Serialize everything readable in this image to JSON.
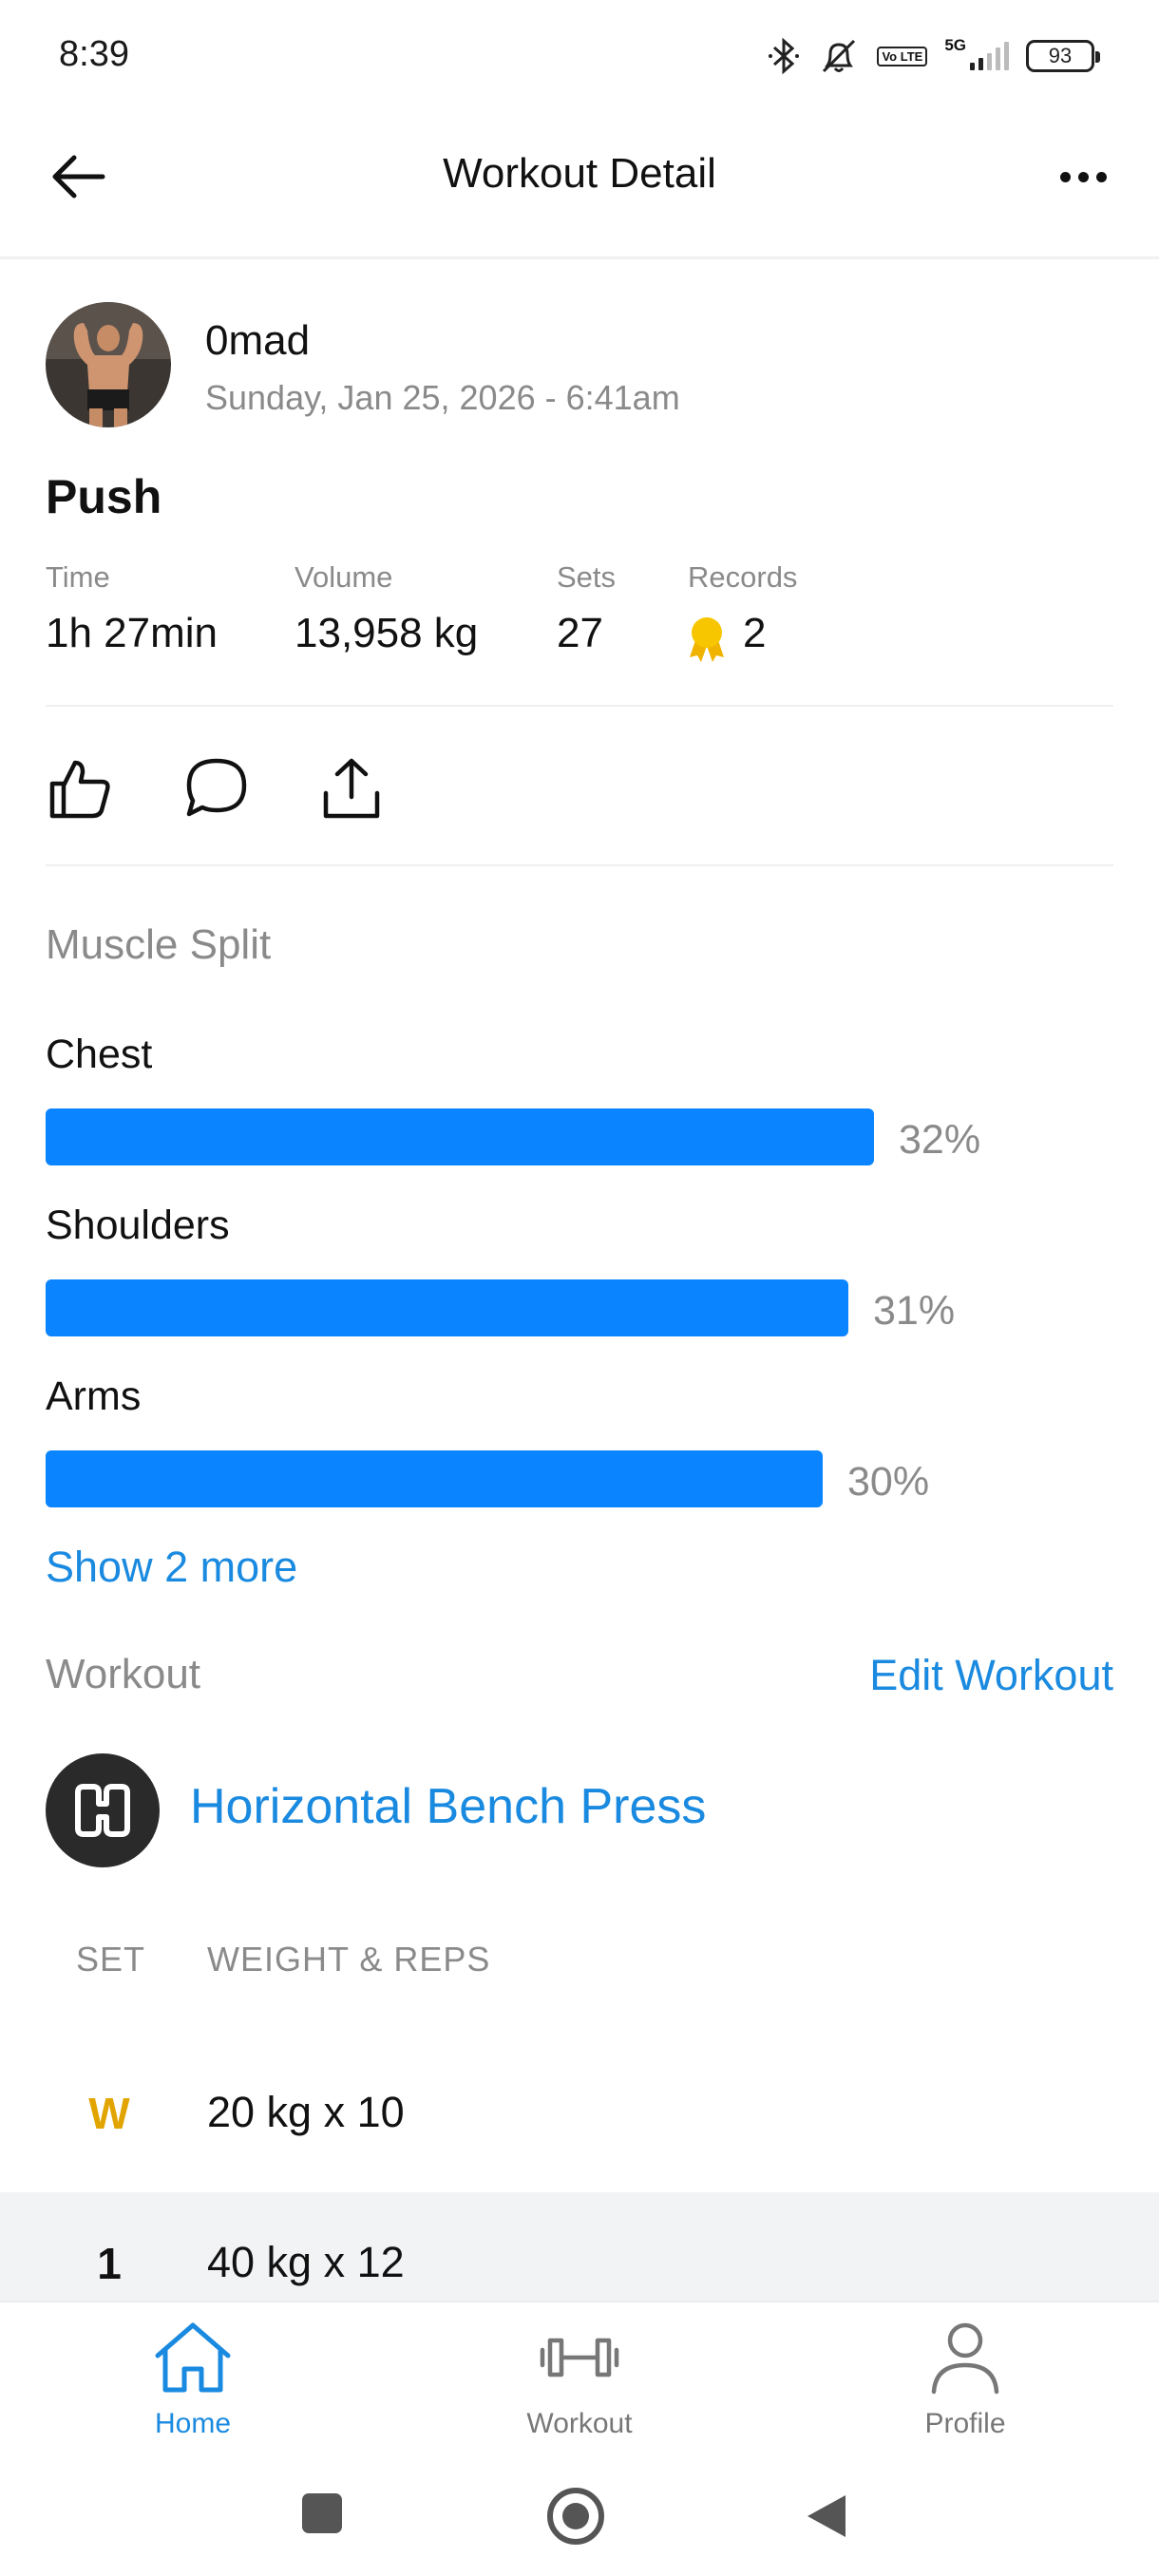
{
  "status_bar": {
    "time": "8:39",
    "battery": "93",
    "network": "5G",
    "volte": "Vo LTE"
  },
  "header": {
    "title": "Workout Detail"
  },
  "profile": {
    "username": "0mad",
    "datetime": "Sunday, Jan 25, 2026 - 6:41am"
  },
  "workout": {
    "name": "Push",
    "stats": [
      {
        "label": "Time",
        "value": "1h 27min"
      },
      {
        "label": "Volume",
        "value": "13,958 kg"
      },
      {
        "label": "Sets",
        "value": "27"
      },
      {
        "label": "Records",
        "value": "2"
      }
    ]
  },
  "muscle_split": {
    "title": "Muscle Split",
    "items": [
      {
        "label": "Chest",
        "percent": 32,
        "percent_text": "32%"
      },
      {
        "label": "Shoulders",
        "percent": 31,
        "percent_text": "31%"
      },
      {
        "label": "Arms",
        "percent": 30,
        "percent_text": "30%"
      }
    ],
    "show_more": "Show 2 more"
  },
  "workout_section": {
    "title": "Workout",
    "edit_label": "Edit Workout",
    "exercise": {
      "name": "Horizontal Bench Press",
      "columns": {
        "set": "SET",
        "weight_reps": "WEIGHT & REPS"
      },
      "sets": [
        {
          "set": "W",
          "value": "20 kg x 10"
        },
        {
          "set": "1",
          "value": "40 kg x 12"
        }
      ]
    }
  },
  "nav": {
    "home": "Home",
    "workout": "Workout",
    "profile": "Profile"
  },
  "colors": {
    "accent": "#0a84ff",
    "link": "#1a8ae0",
    "warmup": "#e2a400",
    "muted": "#8a8a8a",
    "row_highlight": "#f2f3f5"
  }
}
